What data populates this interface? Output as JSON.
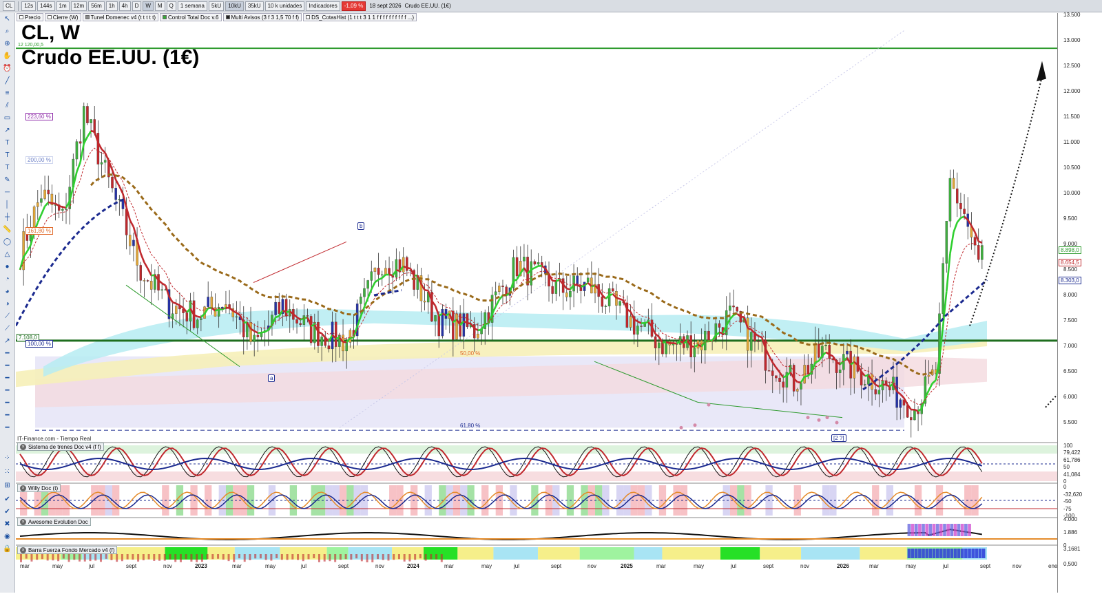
{
  "toolbar": {
    "symbol": "CL",
    "timeframes": [
      "12s",
      "144s",
      "1m",
      "12m",
      "56m",
      "1h",
      "4h",
      "D",
      "W",
      "M",
      "Q"
    ],
    "active_timeframe": "W",
    "period": "1 semana",
    "ticks": [
      "5kU",
      "10kU",
      "35kU"
    ],
    "active_tick": "10kU",
    "units": "10 k unidades",
    "indicators": "Indicadores",
    "change": "-1,09 %",
    "date": "18 sept 2026",
    "instrument": "Crudo EE.UU. (1€)"
  },
  "legend_chips": [
    {
      "label": "Precio",
      "color": "#ffffff"
    },
    {
      "label": "Cierre (W)",
      "color": "#ffffff"
    },
    {
      "label": "Tunel Domenec v4 (t t t t t)",
      "color": "#8a8a8a"
    },
    {
      "label": "Control Total Doc v.6",
      "color": "#3aa63a"
    },
    {
      "label": "Multi Avisos (3 f 3 1,5 70 f f)",
      "color": "#222222"
    },
    {
      "label": "DS_CotasHist (1 t t t 3 1 1 f f f f f f f f f f ...)",
      "color": "#ffffff"
    }
  ],
  "chart_title": "CL, W",
  "chart_subtitle": "Crudo EE.UU. (1€)",
  "top_price_tag": "12 120,00,5",
  "source": "IT-Finance.com - Tiempo Real",
  "fib_labels": {
    "f223": "223,60 %",
    "f200": "200,00 %",
    "f161": "161,80 %",
    "f100": "100,00 %",
    "f50": "50,00 %",
    "f618": "61,80 %",
    "level_7108": "7.108,0"
  },
  "wave_labels": {
    "a": "a",
    "b": "b",
    "c2": "[2 ?]"
  },
  "right_axis_labels": [
    "13.500",
    "13.000",
    "12.500",
    "12.000",
    "11.500",
    "11.000",
    "10.500",
    "10.000",
    "9.500",
    "9.000",
    "8.500",
    "8.000",
    "7.500",
    "7.000",
    "6.500",
    "6.000",
    "5.500"
  ],
  "right_tags": [
    {
      "text": "8.898,0",
      "color": "#2e9b2e"
    },
    {
      "text": "8.654,5",
      "color": "#c0282d"
    },
    {
      "text": "8.303,0",
      "color": "#1b2a8f"
    }
  ],
  "panels": [
    {
      "name": "Sistema de trenes Doc v4 (f f)",
      "labels": [
        "100",
        "79,422",
        "61,786",
        "50",
        "41,084",
        "0"
      ]
    },
    {
      "name": "Willy Doc (t)",
      "labels": [
        "0",
        "-32,620",
        "-50",
        "-75",
        "-100"
      ]
    },
    {
      "name": "Awesome Evolution Doc",
      "labels": [
        "4.000",
        "1.886",
        "0"
      ]
    },
    {
      "name": "Barra Fuerza Fondo Mercado v4 (f)",
      "labels": [
        "3,1681",
        "0,500"
      ]
    }
  ],
  "x_labels": [
    "mar",
    "may",
    "jul",
    "sept",
    "nov",
    "2023",
    "mar",
    "may",
    "jul",
    "sept",
    "nov",
    "2024",
    "mar",
    "may",
    "jul",
    "sept",
    "nov",
    "2025",
    "mar",
    "may",
    "jul",
    "sept",
    "nov",
    "2026",
    "mar",
    "may",
    "jul",
    "sept",
    "nov",
    "ene"
  ],
  "colors": {
    "bull_candle": "#3fae3f",
    "bear_candle": "#c0282d",
    "neutral_candle": "#e0a63a",
    "blue_candle": "#2633a6",
    "support_line": "#2e8b2e",
    "top_line": "#2e9b2e"
  }
}
